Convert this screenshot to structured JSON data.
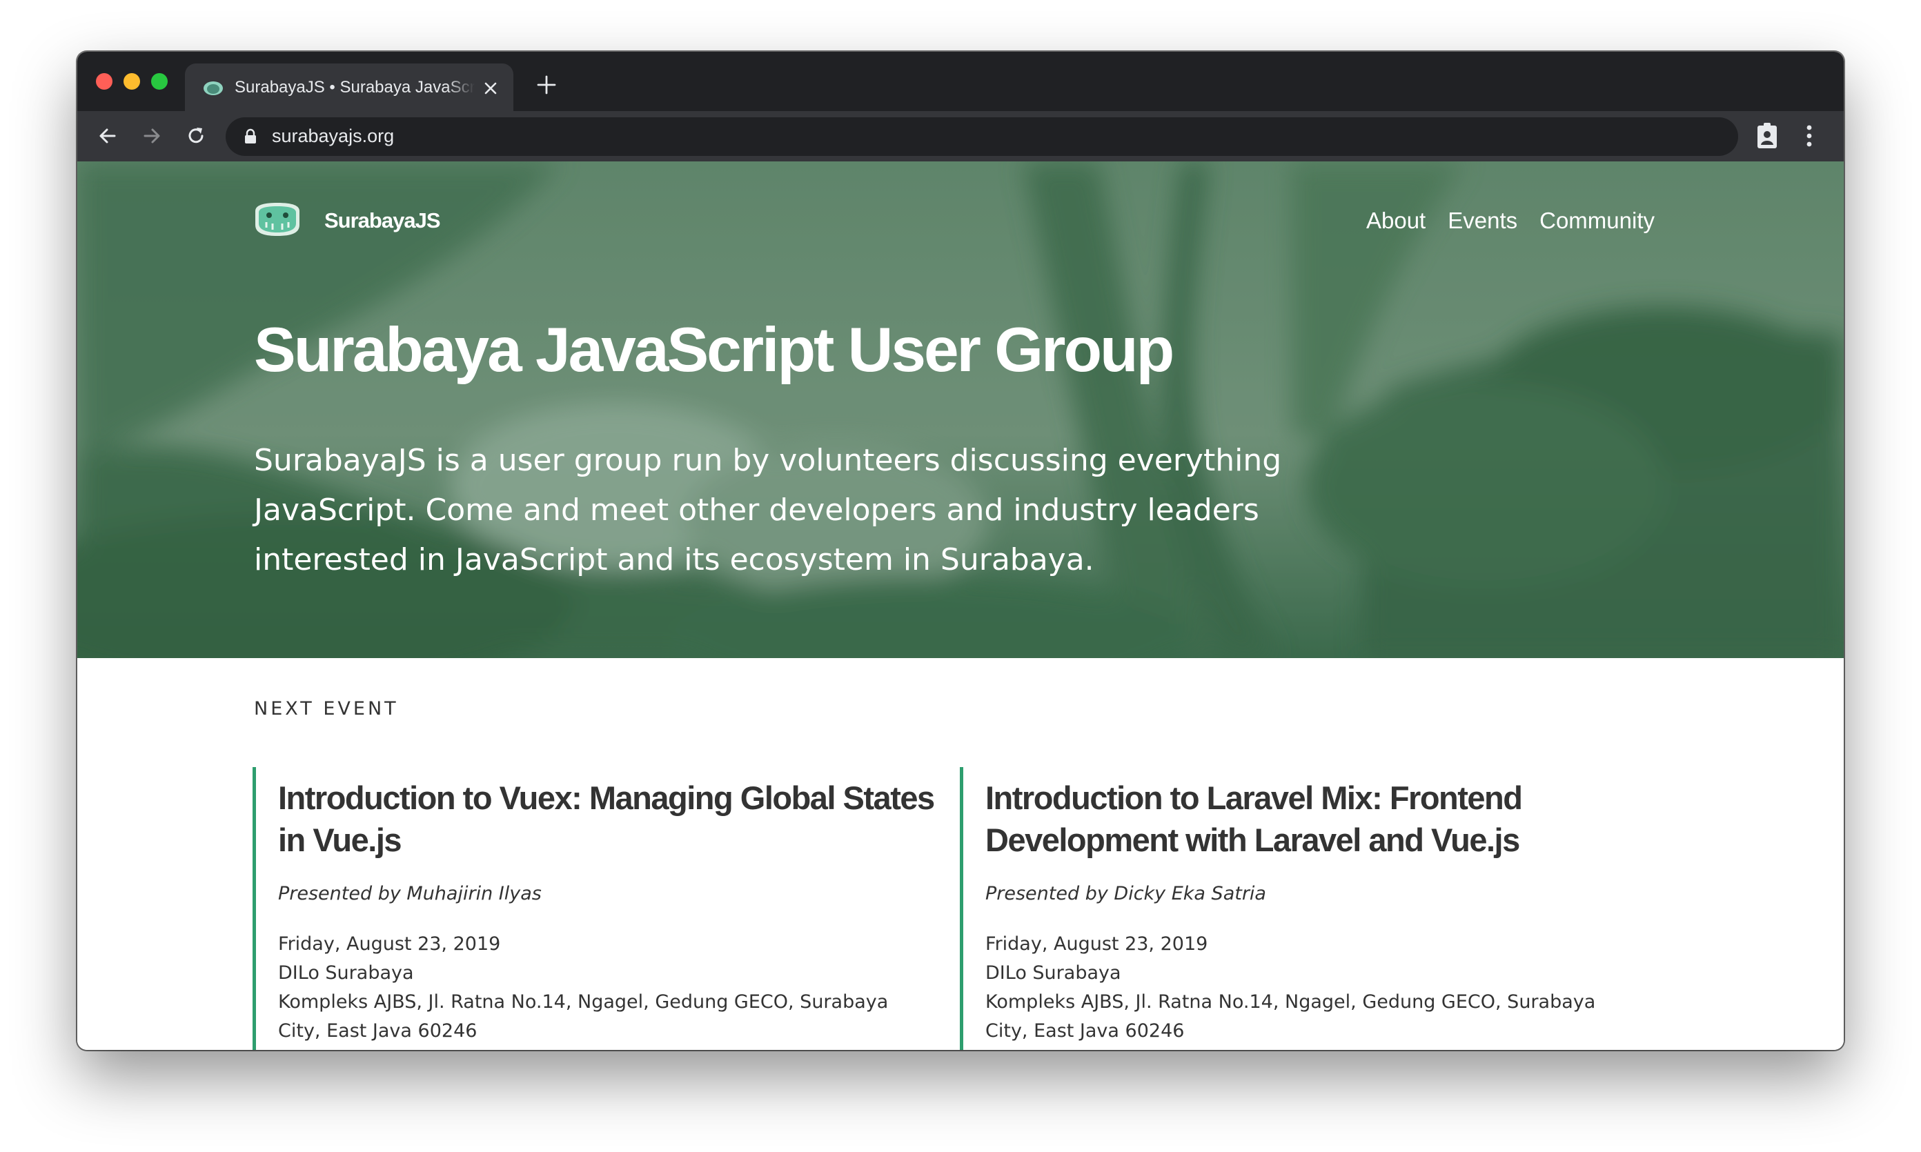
{
  "browser": {
    "tab": {
      "title": "SurabayaJS • Surabaya JavaScript User Group",
      "favicon": "surabayajs-logo-icon"
    },
    "url": "surabayajs.org",
    "icons": [
      "close-icon",
      "plus-icon",
      "back-arrow-icon",
      "forward-arrow-icon",
      "reload-icon",
      "lock-icon",
      "profile-badge-icon",
      "kebab-menu-icon"
    ]
  },
  "site": {
    "brand": "SurabayaJS",
    "nav": [
      "About",
      "Events",
      "Community"
    ],
    "hero": {
      "title": "Surabaya JavaScript User Group",
      "description": "SurabayaJS is a user group run by volunteers discussing everything JavaScript. Come and meet other developers and industry leaders interested in JavaScript and its ecosystem in Surabaya."
    },
    "next_event": {
      "label": "NEXT EVENT",
      "cards": [
        {
          "title": "Introduction to Vuex: Managing Global States in Vue.js",
          "presenter": "Presented by Muhajirin Ilyas",
          "date": "Friday, August 23, 2019",
          "venue": "DILo Surabaya",
          "address_line1": "Kompleks AJBS, Jl. Ratna No.14, Ngagel, Gedung GECO, Surabaya",
          "address_line2": "City, East Java 60246"
        },
        {
          "title": "Introduction to Laravel Mix: Frontend Development with Laravel and Vue.js",
          "presenter": "Presented by Dicky Eka Satria",
          "date": "Friday, August 23, 2019",
          "venue": "DILo Surabaya",
          "address_line1": "Kompleks AJBS, Jl. Ratna No.14, Ngagel, Gedung GECO, Surabaya",
          "address_line2": "City, East Java 60246"
        }
      ]
    }
  },
  "colors": {
    "hero_tint": "#5e8268",
    "accent": "#2e9e6e",
    "chrome_dark": "#202124",
    "chrome_toolbar": "#35363a"
  }
}
